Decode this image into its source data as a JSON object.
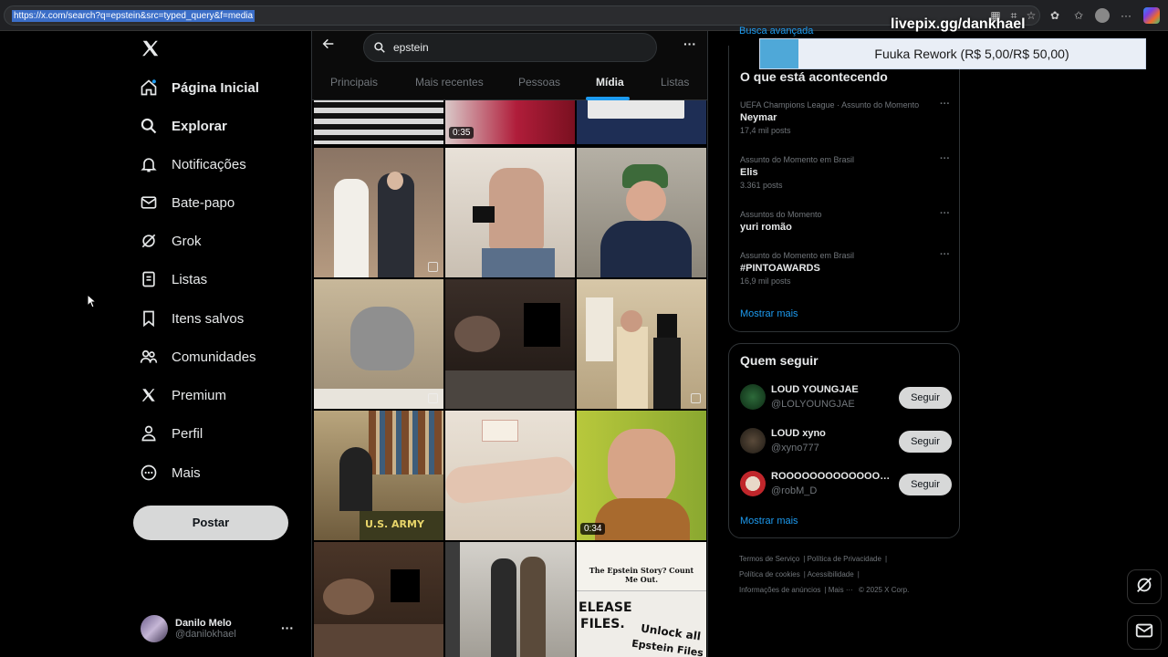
{
  "browser": {
    "url": "https://x.com/search?q=epstein&src=typed_query&f=media"
  },
  "overlay": {
    "handle": "livepix.gg/dankhael",
    "donation": "Fuuka Rework (R$ 5,00/R$ 50,00)"
  },
  "nav": {
    "items": [
      {
        "label": "Página Inicial",
        "icon": "home-icon"
      },
      {
        "label": "Explorar",
        "icon": "search-icon"
      },
      {
        "label": "Notificações",
        "icon": "bell-icon"
      },
      {
        "label": "Bate-papo",
        "icon": "mail-icon"
      },
      {
        "label": "Grok",
        "icon": "grok-icon"
      },
      {
        "label": "Listas",
        "icon": "list-icon"
      },
      {
        "label": "Itens salvos",
        "icon": "bookmark-icon"
      },
      {
        "label": "Comunidades",
        "icon": "people-icon"
      },
      {
        "label": "Premium",
        "icon": "x-icon"
      },
      {
        "label": "Perfil",
        "icon": "person-icon"
      },
      {
        "label": "Mais",
        "icon": "more-circle-icon"
      }
    ],
    "post_label": "Postar"
  },
  "profile": {
    "name": "Danilo Melo",
    "handle": "@danilokhael"
  },
  "search": {
    "query": "epstein"
  },
  "tabs": [
    "Principais",
    "Mais recentes",
    "Pessoas",
    "Mídia",
    "Listas"
  ],
  "media": {
    "durations": [
      "0:35",
      "0:34"
    ],
    "newspaper_headline": "The Epstein Story? Count Me Out.",
    "sign_text_1": "ELEASE",
    "sign_text_2": "FILES.",
    "sign_text_3": "Unlock all",
    "sign_text_4": "Epstein Files",
    "army_text": "U.S. ARMY"
  },
  "right": {
    "advanced_search": "Busca avançada",
    "trends_title": "O que está acontecendo",
    "trends": [
      {
        "category": "UEFA Champions League · Assunto do Momento",
        "name": "Neymar",
        "count": "17,4 mil posts"
      },
      {
        "category": "Assunto do Momento em Brasil",
        "name": "Elis",
        "count": "3.361 posts"
      },
      {
        "category": "Assuntos do Momento",
        "name": "yuri romão",
        "count": ""
      },
      {
        "category": "Assunto do Momento em Brasil",
        "name": "#PINTOAWARDS",
        "count": "16,9 mil posts"
      }
    ],
    "show_more": "Mostrar mais",
    "who_to_follow_title": "Quem seguir",
    "follows": [
      {
        "name": "LOUD YOUNGJAE",
        "handle": "@LOLYOUNGJAE",
        "button": "Seguir"
      },
      {
        "name": "LOUD xyno",
        "handle": "@xyno777",
        "button": "Seguir"
      },
      {
        "name": "ROOOOOOOOOOOOOO...",
        "handle": "@robM_D",
        "button": "Seguir"
      }
    ],
    "footer": [
      "Termos de Serviço",
      "Política de Privacidade",
      "Política de cookies",
      "Acessibilidade",
      "Informações de anúncios",
      "Mais ···",
      "© 2025 X Corp."
    ]
  },
  "colors": {
    "accent": "#1d9bf0",
    "background": "#000000",
    "border": "#2f3336",
    "muted": "#71767b"
  }
}
